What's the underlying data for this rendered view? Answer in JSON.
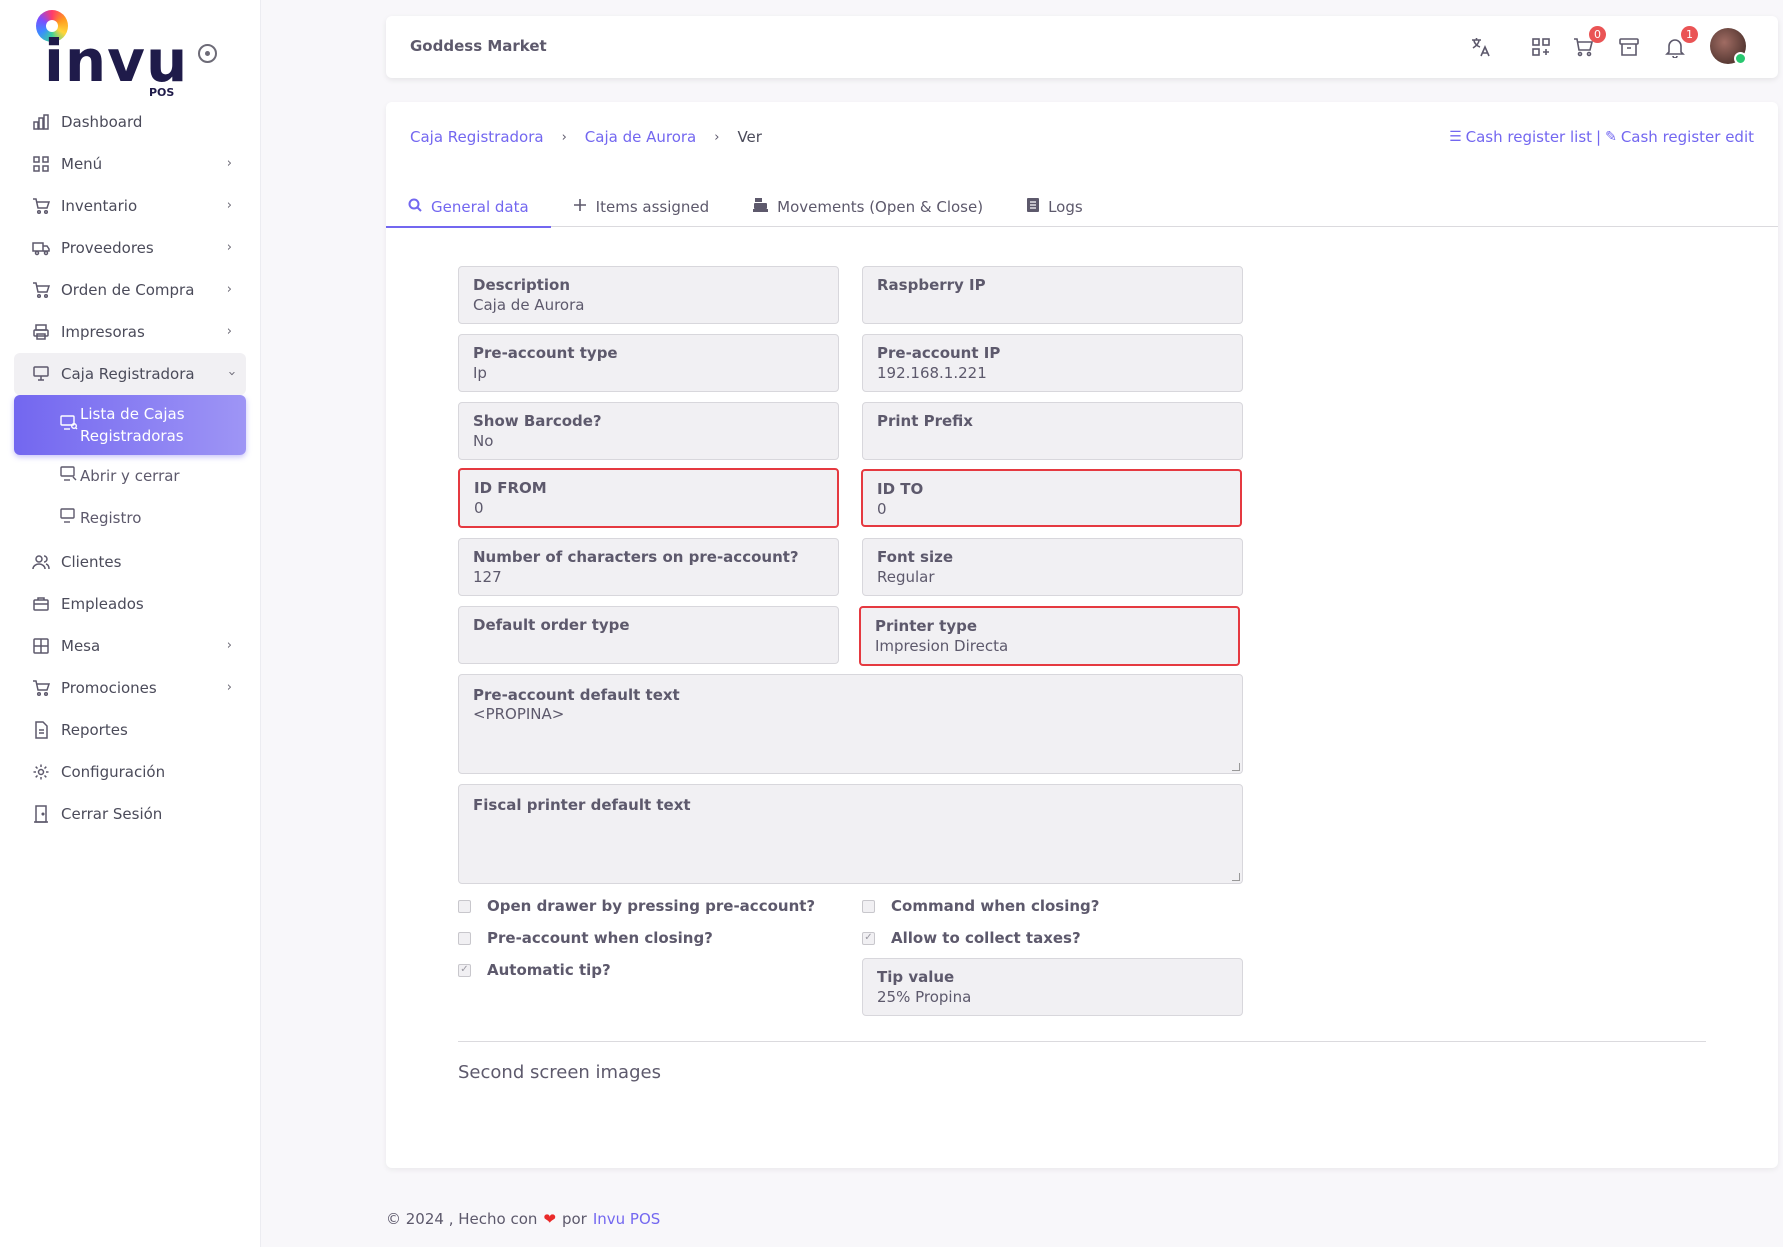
{
  "logo": {
    "text": "invu",
    "sub": "POS"
  },
  "sidebar": {
    "items": [
      {
        "label": "Dashboard",
        "icon": "chart-bar-icon"
      },
      {
        "label": "Menú",
        "icon": "grid-icon"
      },
      {
        "label": "Inventario",
        "icon": "cart-icon"
      },
      {
        "label": "Proveedores",
        "icon": "truck-icon"
      },
      {
        "label": "Orden de Compra",
        "icon": "cart-icon"
      },
      {
        "label": "Impresoras",
        "icon": "printer-icon"
      },
      {
        "label": "Caja Registradora",
        "icon": "register-icon"
      },
      {
        "label": "Clientes",
        "icon": "users-icon"
      },
      {
        "label": "Empleados",
        "icon": "briefcase-icon"
      },
      {
        "label": "Mesa",
        "icon": "table-icon"
      },
      {
        "label": "Promociones",
        "icon": "cart-icon"
      },
      {
        "label": "Reportes",
        "icon": "document-icon"
      },
      {
        "label": "Configuración",
        "icon": "gear-icon"
      },
      {
        "label": "Cerrar Sesión",
        "icon": "door-icon"
      }
    ],
    "subitems": [
      {
        "label": "Lista de Cajas Registradoras"
      },
      {
        "label": "Abrir y cerrar"
      },
      {
        "label": "Registro"
      }
    ]
  },
  "navbar": {
    "store": "Goddess Market",
    "cart_count": "0",
    "notif_count": "1"
  },
  "breadcrumb": {
    "level1": "Caja Registradora",
    "level2": "Caja de Aurora",
    "current": "Ver"
  },
  "header_links": {
    "list": "Cash register list",
    "sep": "|",
    "edit": "Cash register edit"
  },
  "tabs": [
    {
      "label": "General data"
    },
    {
      "label": "Items assigned"
    },
    {
      "label": "Movements (Open & Close)"
    },
    {
      "label": "Logs"
    }
  ],
  "fields": {
    "description": {
      "label": "Description",
      "value": "Caja de Aurora"
    },
    "raspberry_ip": {
      "label": "Raspberry IP",
      "value": ""
    },
    "pre_account_type": {
      "label": "Pre-account type",
      "value": "Ip"
    },
    "pre_account_ip": {
      "label": "Pre-account IP",
      "value": "192.168.1.221"
    },
    "show_barcode": {
      "label": "Show Barcode?",
      "value": "No"
    },
    "print_prefix": {
      "label": "Print Prefix",
      "value": ""
    },
    "id_from": {
      "label": "ID FROM",
      "value": "0"
    },
    "id_to": {
      "label": "ID TO",
      "value": "0"
    },
    "num_chars": {
      "label": "Number of characters on pre-account?",
      "value": "127"
    },
    "font_size": {
      "label": "Font size",
      "value": "Regular"
    },
    "default_order_type": {
      "label": "Default order type",
      "value": ""
    },
    "printer_type": {
      "label": "Printer type",
      "value": "Impresion Directa"
    },
    "pre_account_text": {
      "label": "Pre-account default text",
      "value": "<PROPINA>"
    },
    "fiscal_text": {
      "label": "Fiscal printer default text",
      "value": ""
    },
    "tip_value": {
      "label": "Tip value",
      "value": "25% Propina"
    }
  },
  "checks": {
    "open_drawer": {
      "label": "Open drawer by pressing pre-account?",
      "checked": false
    },
    "command_closing": {
      "label": "Command when closing?",
      "checked": false
    },
    "pre_account_closing": {
      "label": "Pre-account when closing?",
      "checked": false
    },
    "collect_taxes": {
      "label": "Allow to collect taxes?",
      "checked": true
    },
    "automatic_tip": {
      "label": "Automatic tip?",
      "checked": true
    }
  },
  "second_screen": "Second screen images",
  "footer": {
    "text": "© 2024 , Hecho con",
    "by": "por",
    "link": "Invu POS"
  }
}
